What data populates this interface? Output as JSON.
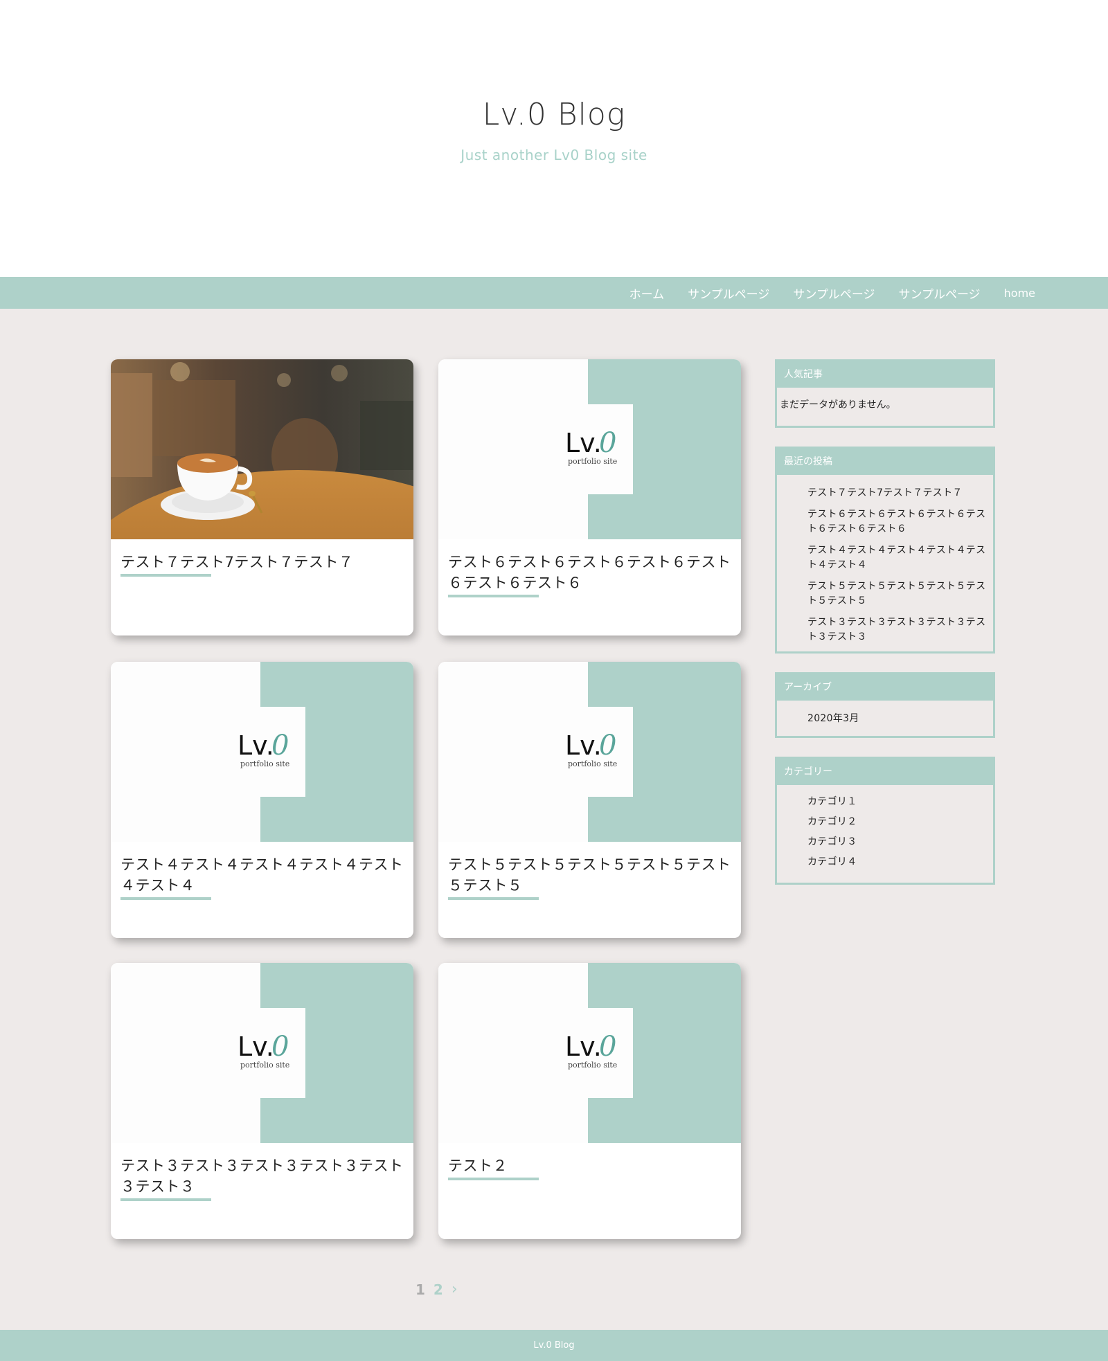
{
  "header": {
    "title": "Lv.0 Blog",
    "description": "Just another Lv0 Blog site"
  },
  "nav": {
    "items": [
      "ホーム",
      "サンプルページ",
      "サンプルページ",
      "サンプルページ",
      "home"
    ]
  },
  "logo": {
    "text_main": "Lv.",
    "text_accent": "0",
    "subtitle": "portfolio site"
  },
  "posts": [
    {
      "title": "テスト７テスト7テスト７テスト７",
      "thumbnail": "coffee-photo"
    },
    {
      "title": "テスト６テスト６テスト６テスト６テスト６テスト６テスト６",
      "thumbnail": "lv0-logo"
    },
    {
      "title": "テスト４テスト４テスト４テスト４テスト４テスト４",
      "thumbnail": "lv0-logo"
    },
    {
      "title": "テスト５テスト５テスト５テスト５テスト５テスト５",
      "thumbnail": "lv0-logo"
    },
    {
      "title": "テスト３テスト３テスト３テスト３テスト３テスト３",
      "thumbnail": "lv0-logo"
    },
    {
      "title": "テスト２",
      "thumbnail": "lv0-logo"
    }
  ],
  "sidebar": {
    "popular": {
      "title": "人気記事",
      "empty": "まだデータがありません。"
    },
    "recent": {
      "title": "最近の投稿",
      "items": [
        "テスト７テスト7テスト７テスト７",
        "テスト６テスト６テスト６テスト６テスト６テスト６テスト６",
        "テスト４テスト４テスト４テスト４テスト４テスト４",
        "テスト５テスト５テスト５テスト５テスト５テスト５",
        "テスト３テスト３テスト３テスト３テスト３テスト３"
      ]
    },
    "archive": {
      "title": "アーカイブ",
      "items": [
        "2020年3月"
      ]
    },
    "categories": {
      "title": "カテゴリー",
      "items": [
        "カテゴリ１",
        "カテゴリ２",
        "カテゴリ３",
        "カテゴリ４"
      ]
    }
  },
  "pagination": {
    "pages": [
      "1",
      "2"
    ],
    "next": "›",
    "current": "1"
  },
  "footer": {
    "text": "Lv.0 Blog"
  },
  "colors": {
    "accent": "#aed1c9",
    "background": "#eeeae9",
    "text": "#222222"
  }
}
